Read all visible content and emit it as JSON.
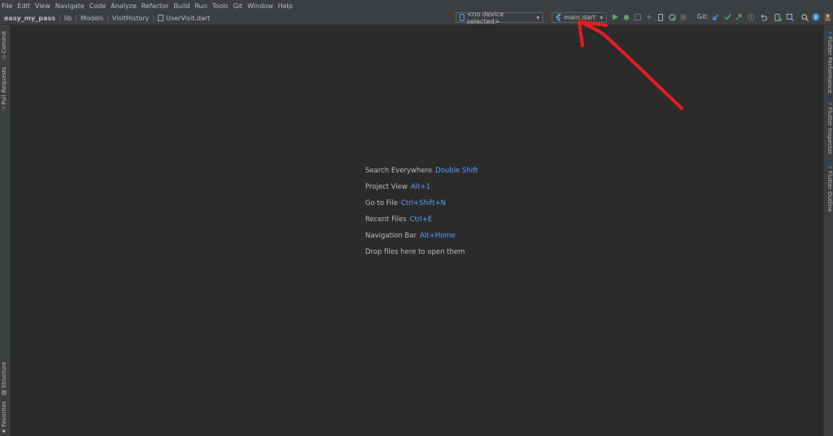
{
  "menu": [
    "File",
    "Edit",
    "View",
    "Navigate",
    "Code",
    "Analyze",
    "Refactor",
    "Build",
    "Run",
    "Tools",
    "Git",
    "Window",
    "Help"
  ],
  "breadcrumbs": [
    "easy_my_pass",
    "lib",
    "Models",
    "VisitHistory",
    "UserVisit.dart"
  ],
  "device_selector": {
    "label": "<no device selected>"
  },
  "run_config": {
    "label": "main.dart"
  },
  "git": {
    "label": "Git:"
  },
  "left_tool_windows": [
    "Commit",
    "Pull Requests",
    "Structure",
    "Favorites"
  ],
  "right_tool_windows": [
    "Flutter Performance",
    "Flutter Inspector",
    "Flutter Outline"
  ],
  "editor_hints": [
    {
      "text": "Search Everywhere",
      "shortcut": "Double Shift"
    },
    {
      "text": "Project View",
      "shortcut": "Alt+1"
    },
    {
      "text": "Go to File",
      "shortcut": "Ctrl+Shift+N"
    },
    {
      "text": "Recent Files",
      "shortcut": "Ctrl+E"
    },
    {
      "text": "Navigation Bar",
      "shortcut": "Alt+Home"
    },
    {
      "text": "Drop files here to open them",
      "shortcut": ""
    }
  ],
  "colors": {
    "background": "#2b2b2b",
    "panel": "#3c3f41",
    "shortcut": "#589df6",
    "annotation": "#e81c1c"
  }
}
